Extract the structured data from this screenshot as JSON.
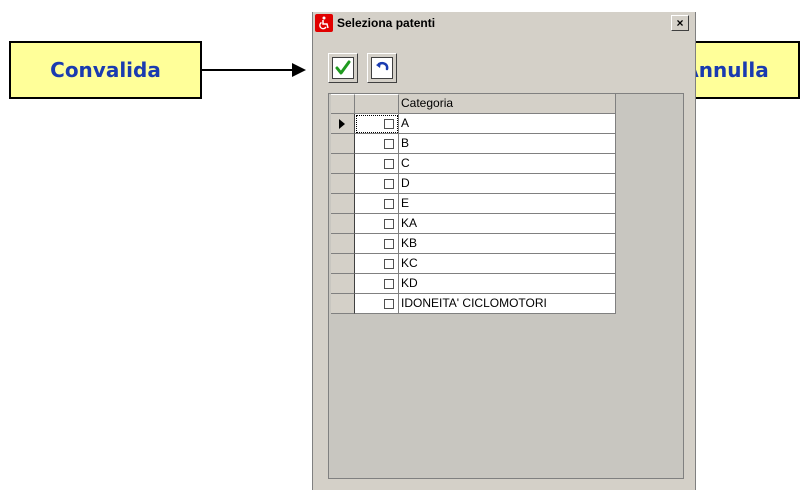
{
  "window": {
    "title": "Seleziona patenti",
    "title_icon": "wheelchair-icon",
    "close_label": "×"
  },
  "toolbar": {
    "confirm_icon": "checkmark-icon",
    "cancel_icon": "undo-icon"
  },
  "grid": {
    "header": "Categoria",
    "rows": [
      {
        "label": "A",
        "checked": false
      },
      {
        "label": "B",
        "checked": false
      },
      {
        "label": "C",
        "checked": false
      },
      {
        "label": "D",
        "checked": false
      },
      {
        "label": "E",
        "checked": false
      },
      {
        "label": "KA",
        "checked": false
      },
      {
        "label": "KB",
        "checked": false
      },
      {
        "label": "KC",
        "checked": false
      },
      {
        "label": "KD",
        "checked": false
      },
      {
        "label": "IDONEITA' CICLOMOTORI",
        "checked": false
      }
    ]
  },
  "annotations": {
    "left_label": "Convalida",
    "right_label": "Annulla"
  },
  "colors": {
    "callout_bg": "#ffff99",
    "callout_text": "#1a3bb0",
    "check_green": "#1f9a1f",
    "undo_blue": "#1a3bb0"
  }
}
